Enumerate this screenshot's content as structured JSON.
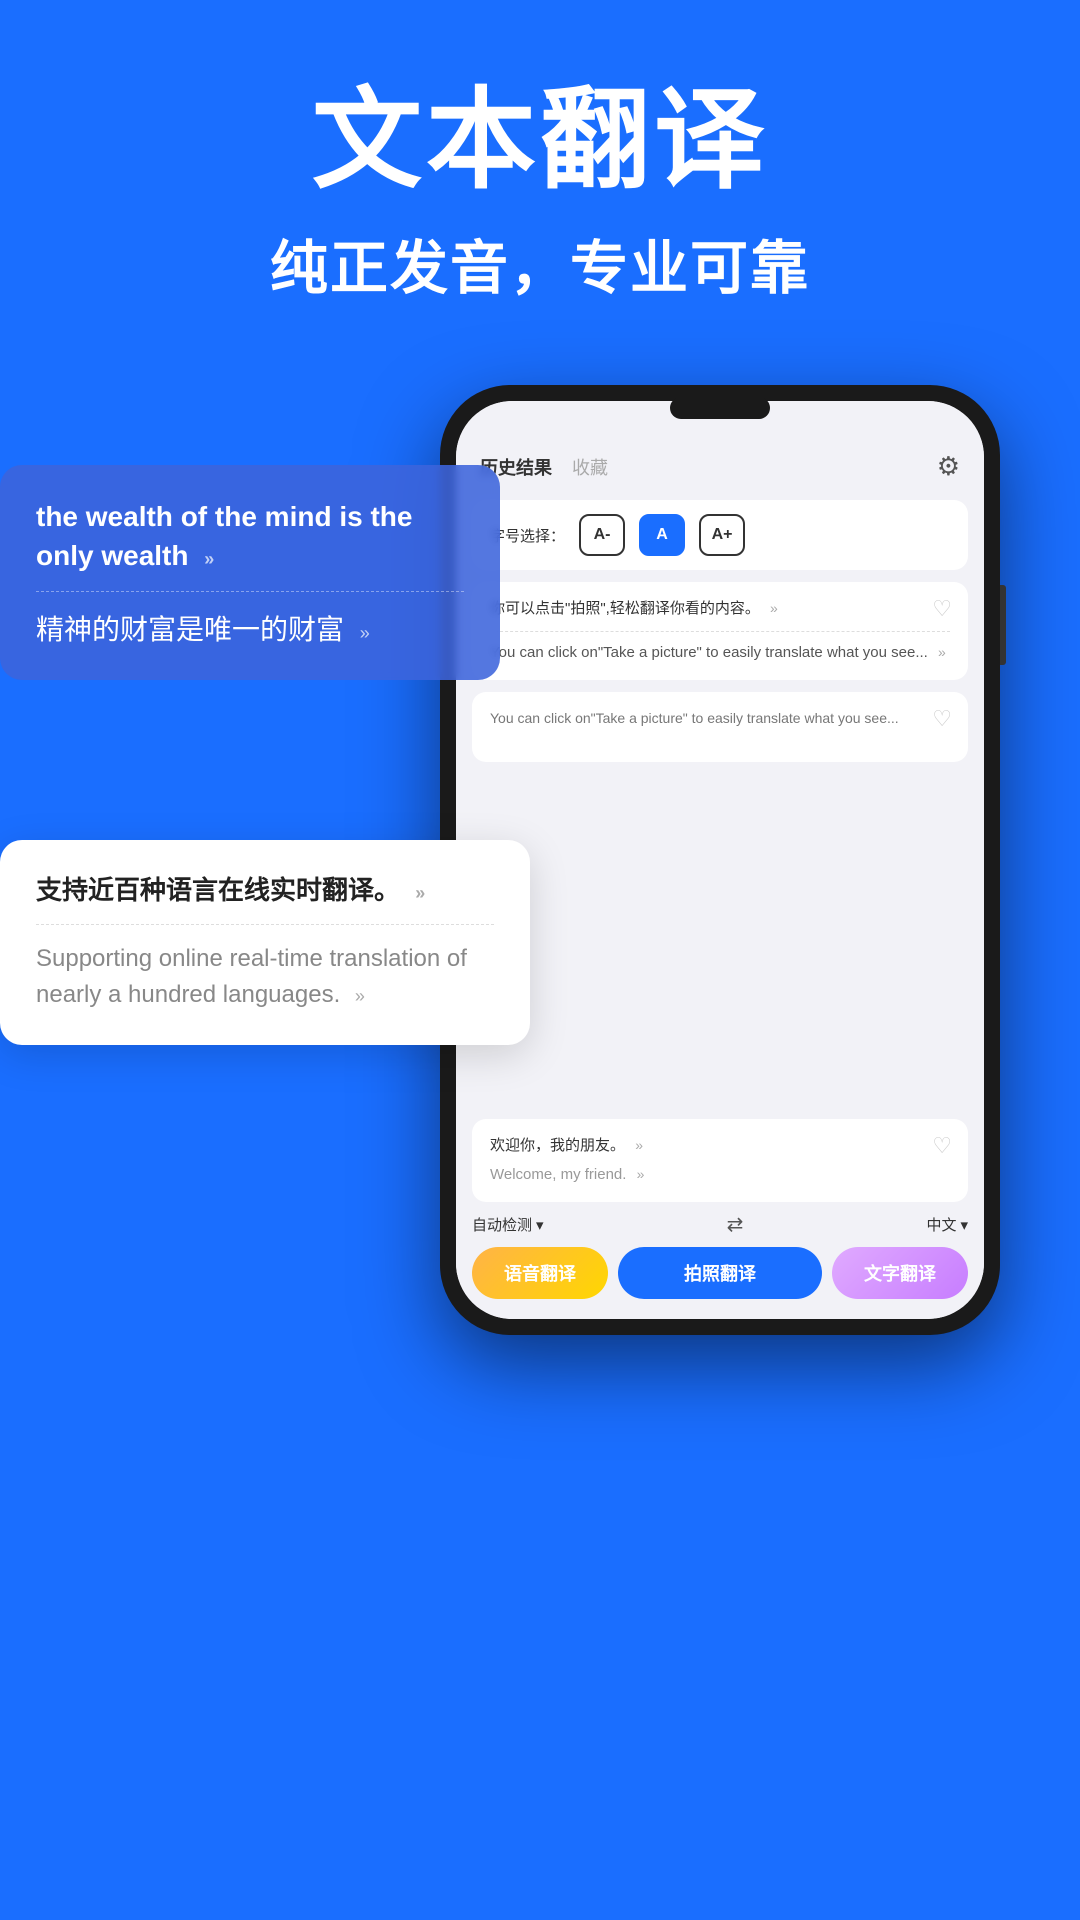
{
  "hero": {
    "title": "文本翻译",
    "subtitle": "纯正发音，专业可靠"
  },
  "phone": {
    "header": {
      "text_left": "历史结果",
      "text_separator": "收藏",
      "gear_symbol": "⚙"
    },
    "float_card_1": {
      "text_en": "the wealth of the mind is the only wealth",
      "text_zh": "精神的财富是唯一的财富",
      "sound_symbol": "»"
    },
    "font_selector": {
      "label": "字号选择：",
      "btn_small": "A-",
      "btn_medium": "A",
      "btn_large": "A+"
    },
    "history_card_1": {
      "text_zh": "你可以点击\"拍照\",轻松翻译你看的内容。",
      "text_en": "You can click on\"Take a picture\" to easily translate what you see...",
      "sound_symbol": "»"
    },
    "float_card_2": {
      "text_zh": "支持近百种语言在线实时翻译。",
      "text_en": "Supporting online real-time translation of nearly a hundred languages.",
      "sound_symbol": "»"
    },
    "history_card_2": {
      "text_zh": "欢迎你，我的朋友。",
      "text_en": "Welcome, my friend.",
      "sound_symbol": "»"
    },
    "lang_bar": {
      "source_lang": "自动检测",
      "target_lang": "中文",
      "dropdown_symbol": "▾",
      "swap_symbol": "⇄"
    },
    "buttons": {
      "voice": "语音翻译",
      "photo": "拍照翻译",
      "text": "文字翻译"
    }
  }
}
